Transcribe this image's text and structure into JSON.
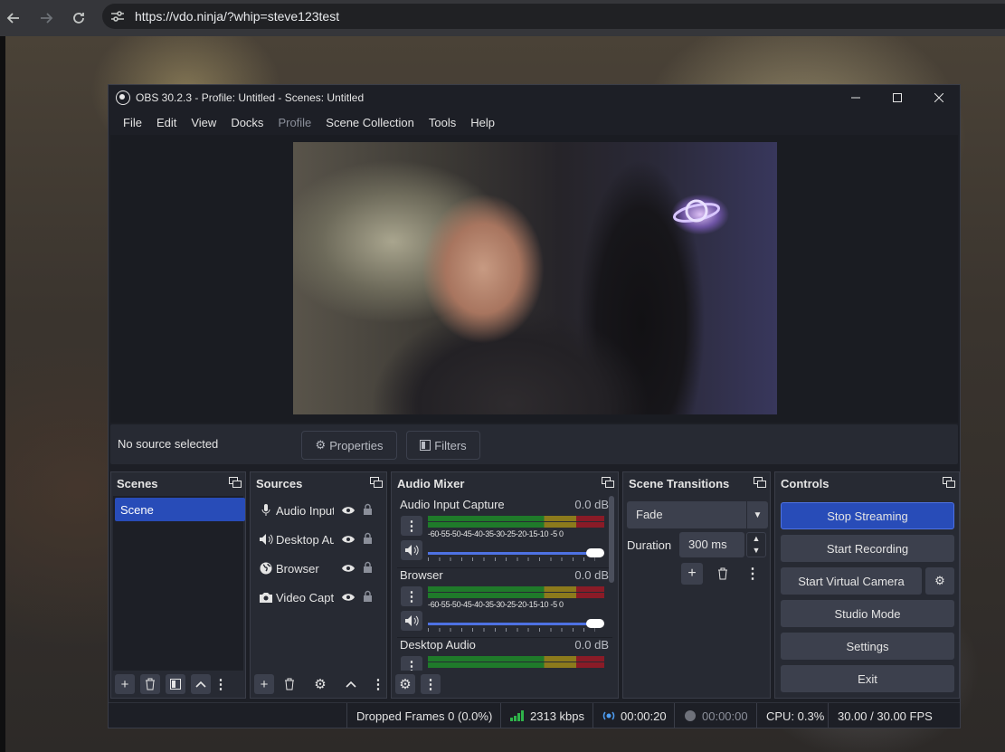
{
  "browser": {
    "url": "https://vdo.ninja/?whip=steve123test"
  },
  "obs": {
    "title": "OBS 30.2.3 - Profile: Untitled - Scenes: Untitled",
    "menus": [
      "File",
      "Edit",
      "View",
      "Docks",
      "Profile",
      "Scene Collection",
      "Tools",
      "Help"
    ],
    "source_bar": {
      "no_source": "No source selected",
      "properties": "Properties",
      "filters": "Filters"
    },
    "scenes": {
      "title": "Scenes",
      "items": [
        "Scene"
      ]
    },
    "sources": {
      "title": "Sources",
      "items": [
        {
          "name": "Audio Input Capture",
          "icon": "microphone-icon"
        },
        {
          "name": "Desktop Audio",
          "icon": "speaker-icon"
        },
        {
          "name": "Browser",
          "icon": "globe-icon"
        },
        {
          "name": "Video Capture Device",
          "icon": "camera-icon"
        }
      ]
    },
    "mixer": {
      "title": "Audio Mixer",
      "scale": "-60-55-50-45-40-35-30-25-20-15-10 -5  0",
      "channels": [
        {
          "name": "Audio Input Capture",
          "db": "0.0 dB"
        },
        {
          "name": "Browser",
          "db": "0.0 dB"
        },
        {
          "name": "Desktop Audio",
          "db": "0.0 dB"
        }
      ]
    },
    "transitions": {
      "title": "Scene Transitions",
      "selected": "Fade",
      "duration_label": "Duration",
      "duration_value": "300 ms"
    },
    "controls": {
      "title": "Controls",
      "stop_streaming": "Stop Streaming",
      "start_recording": "Start Recording",
      "start_virtual_camera": "Start Virtual Camera",
      "studio_mode": "Studio Mode",
      "settings": "Settings",
      "exit": "Exit"
    },
    "status": {
      "dropped_frames": "Dropped Frames 0 (0.0%)",
      "bitrate": "2313 kbps",
      "stream_time": "00:00:20",
      "record_time": "00:00:00",
      "cpu": "CPU: 0.3%",
      "fps": "30.00 / 30.00 FPS"
    }
  },
  "colors": {
    "accent": "#284cb8",
    "meter_green": "#1f7a2a",
    "meter_yellow": "#8c7a1c",
    "meter_red": "#8a1b27"
  }
}
